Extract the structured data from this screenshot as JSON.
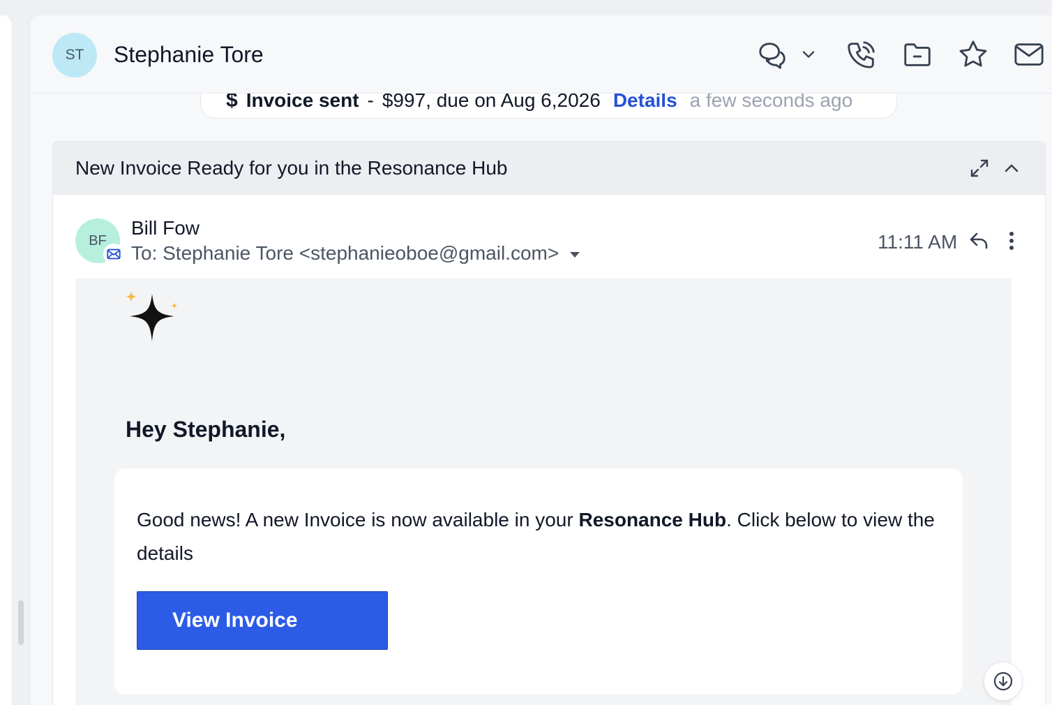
{
  "contact": {
    "initials": "ST",
    "name": "Stephanie Tore",
    "avatar_color": "#bde9f7"
  },
  "header_actions": [
    {
      "name": "conversation-icon"
    },
    {
      "name": "chevron-down-icon"
    },
    {
      "name": "phone-icon"
    },
    {
      "name": "folder-icon"
    },
    {
      "name": "star-icon"
    },
    {
      "name": "mail-icon"
    }
  ],
  "activity": {
    "icon": "dollar-icon",
    "title": "Invoice sent",
    "separator": "-",
    "detail": "$997, due on Aug 6,2026",
    "link": "Details",
    "time": "a few seconds ago"
  },
  "thread": {
    "subject": "New Invoice Ready for you in the Resonance Hub"
  },
  "message": {
    "sender_initials": "BF",
    "sender_avatar_color": "#b6f0dd",
    "sender": "Bill Fow",
    "recipient": "To: Stephanie Tore <stephanieoboe@gmail.com>",
    "time": "11:11 AM"
  },
  "email": {
    "greeting": "Hey Stephanie,",
    "text_before": "Good news! A new Invoice is now available in your ",
    "text_bold": "Resonance Hub",
    "text_after": ". Click below to view the details",
    "button_label": "View Invoice",
    "button_color": "#2c5be6"
  },
  "colors": {
    "link": "#2451d6",
    "sparkle_accent": "#f5b83d"
  }
}
